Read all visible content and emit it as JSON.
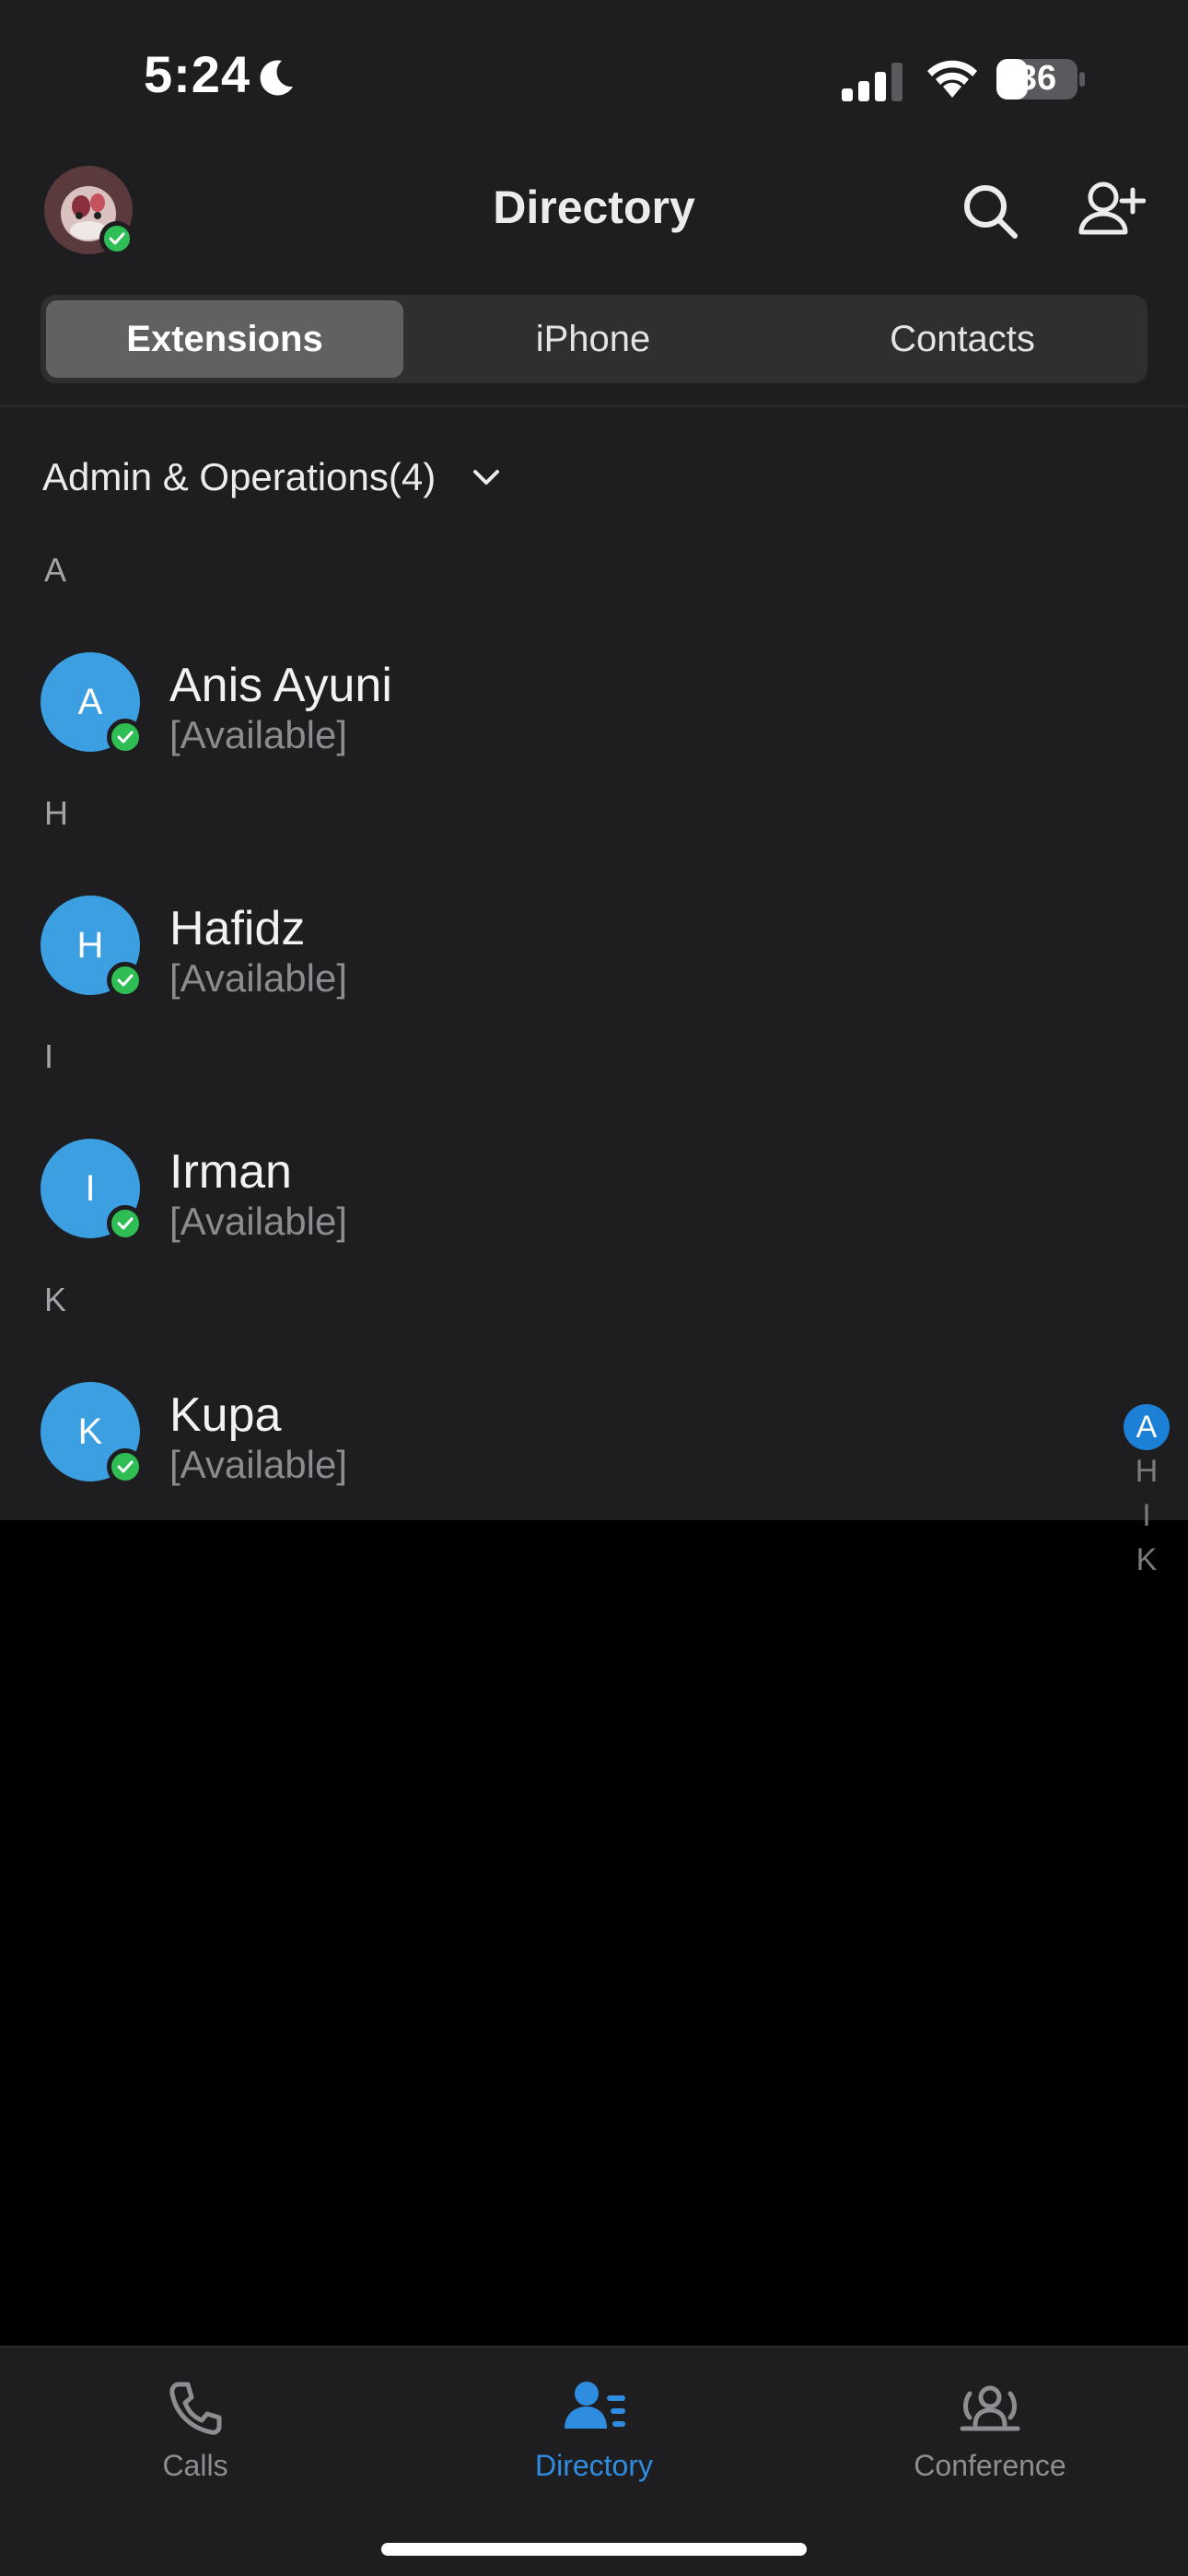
{
  "status_bar": {
    "time": "5:24",
    "battery": "36"
  },
  "header": {
    "title": "Directory"
  },
  "tabs": [
    {
      "label": "Extensions",
      "active": true
    },
    {
      "label": "iPhone",
      "active": false
    },
    {
      "label": "Contacts",
      "active": false
    }
  ],
  "group": {
    "label": "Admin & Operations(4)"
  },
  "sections": [
    {
      "letter": "A",
      "contacts": [
        {
          "initial": "A",
          "name": "Anis Ayuni",
          "status": "[Available]"
        }
      ]
    },
    {
      "letter": "H",
      "contacts": [
        {
          "initial": "H",
          "name": "Hafidz",
          "status": "[Available]"
        }
      ]
    },
    {
      "letter": "I",
      "contacts": [
        {
          "initial": "I",
          "name": "Irman",
          "status": "[Available]"
        }
      ]
    },
    {
      "letter": "K",
      "contacts": [
        {
          "initial": "K",
          "name": "Kupa",
          "status": "[Available]"
        }
      ]
    }
  ],
  "index": [
    "A",
    "H",
    "I",
    "K"
  ],
  "bottom_nav": [
    {
      "label": "Calls",
      "icon": "phone-icon",
      "active": false
    },
    {
      "label": "Directory",
      "icon": "directory-icon",
      "active": true
    },
    {
      "label": "Conference",
      "icon": "conference-icon",
      "active": false
    }
  ],
  "colors": {
    "accent": "#2f8de0",
    "avatar": "#3b9fe1",
    "presence": "#2fbe56",
    "background": "#1e1e20"
  }
}
